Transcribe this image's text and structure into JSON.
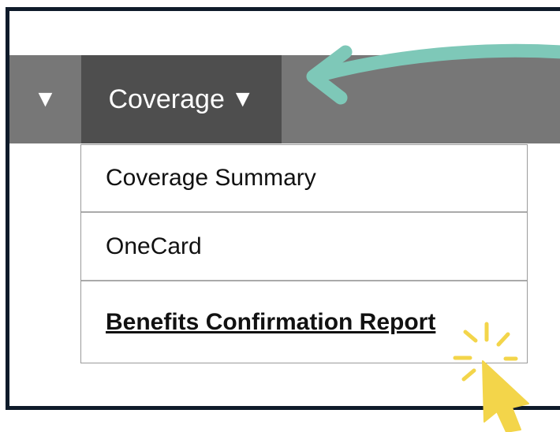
{
  "navbar": {
    "collapse_icon": "▼",
    "coverage_label": "Coverage",
    "coverage_caret": "▼"
  },
  "dropdown": {
    "items": [
      {
        "label": "Coverage Summary"
      },
      {
        "label": "OneCard"
      },
      {
        "label": "Benefits Confirmation Report"
      }
    ]
  },
  "annotations": {
    "arrow_color": "#7ec8b8",
    "cursor_color": "#f3d54a"
  },
  "colors": {
    "navbar_bg": "#777777",
    "active_tab_bg": "#4e4e4e",
    "frame_border": "#0f1b2a"
  }
}
